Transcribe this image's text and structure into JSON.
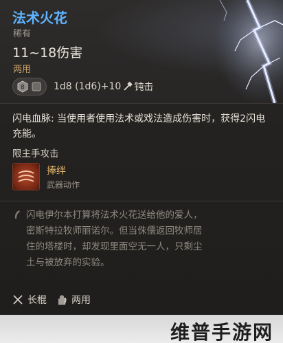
{
  "item": {
    "name": "法术火花",
    "rarity": "稀有",
    "damage_range": "11~18伤害",
    "handedness": "两用",
    "dice_value": "8",
    "damage_formula": "1d8 (1d6)+10",
    "damage_type": "钝击",
    "passive_text": "闪电血脉: 当使用者使用法术或戏法造成伤害时，获得2闪电充能。",
    "requirement": "限主手攻击",
    "weapon_action": {
      "name": "捧绊",
      "type": "武器动作"
    },
    "lore": "闪电伊尔本打算将法术火花送给他的爱人，密斯特拉牧师丽诺尔。但当侏儒返回牧师居住的塔楼时，却发现里面空无一人，只剩尘土与被放弃的实验。",
    "proficiency": "长棍",
    "hand_mode": "两用"
  },
  "watermark": "维普手游网",
  "colors": {
    "title": "#5fb3ff",
    "handedness": "#c9a46a",
    "action_name": "#e0b46a"
  },
  "icons": [
    "dice-icon",
    "bludgeon-icon",
    "weapon-action-icon",
    "lore-quill-icon",
    "quarterstaff-icon",
    "hand-icon"
  ]
}
